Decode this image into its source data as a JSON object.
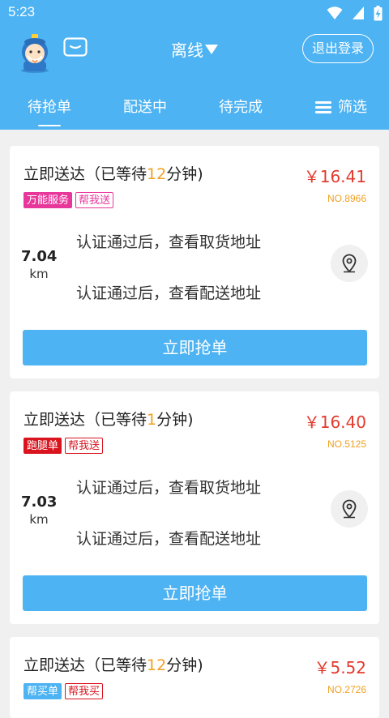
{
  "status_bar": {
    "time": "5:23"
  },
  "header": {
    "mode_label": "离线",
    "logout_label": "退出登录"
  },
  "tabs": [
    {
      "label": "待抢单",
      "active": true
    },
    {
      "label": "配送中",
      "active": false
    },
    {
      "label": "待完成",
      "active": false
    },
    {
      "label": "筛选",
      "active": false
    }
  ],
  "orders": [
    {
      "title_prefix": "立即送达（已等待",
      "wait": "12",
      "title_suffix": "分钟)",
      "price": "￥16.41",
      "order_no": "NO.8966",
      "tag1": "万能服务",
      "tag2": "帮我送",
      "distance": "7.04",
      "unit": "km",
      "pickup": "认证通过后，查看取货地址",
      "delivery": "认证通过后，查看配送地址",
      "button": "立即抢单"
    },
    {
      "title_prefix": "立即送达（已等待",
      "wait": "1",
      "title_suffix": "分钟)",
      "price": "￥16.40",
      "order_no": "NO.5125",
      "tag1": "跑腿单",
      "tag2": "帮我送",
      "distance": "7.03",
      "unit": "km",
      "pickup": "认证通过后，查看取货地址",
      "delivery": "认证通过后，查看配送地址",
      "button": "立即抢单"
    },
    {
      "title_prefix": "立即送达（已等待",
      "wait": "12",
      "title_suffix": "分钟)",
      "price": "￥5.52",
      "order_no": "NO.2726",
      "tag1": "帮买单",
      "tag2": "帮我买"
    }
  ],
  "colors": {
    "primary": "#4db3f2",
    "price": "#e23b2e",
    "accent": "#f0a020",
    "tag_pink": "#e8379a",
    "tag_red": "#d9141e"
  },
  "icons": [
    "wifi-icon",
    "signal-icon",
    "battery-icon",
    "avatar-icon",
    "message-icon",
    "dropdown-triangle-icon",
    "filter-icon",
    "location-pin-icon"
  ]
}
